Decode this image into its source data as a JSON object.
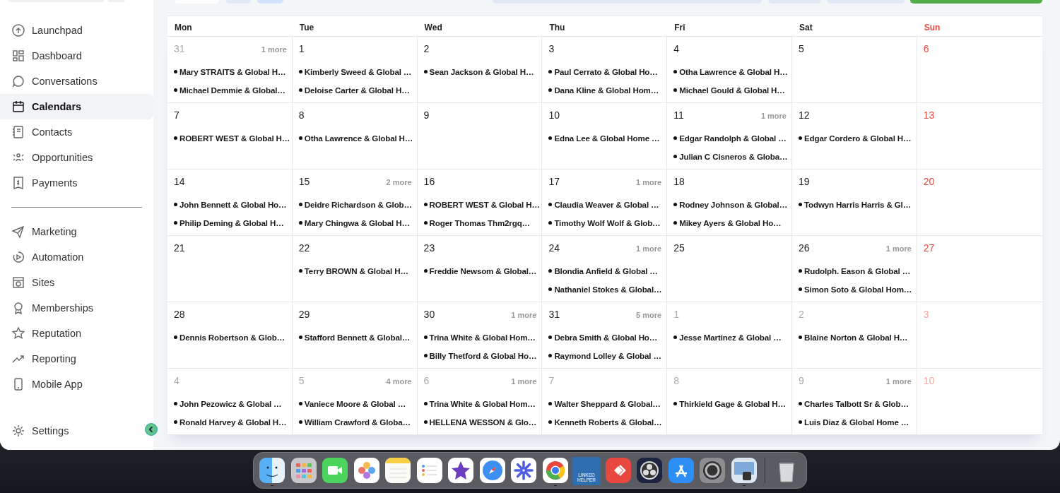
{
  "sidebar": {
    "groups": [
      [
        {
          "label": "Launchpad",
          "selected": false
        },
        {
          "label": "Dashboard",
          "selected": false
        },
        {
          "label": "Conversations",
          "selected": false
        },
        {
          "label": "Calendars",
          "selected": true
        },
        {
          "label": "Contacts",
          "selected": false
        },
        {
          "label": "Opportunities",
          "selected": false
        },
        {
          "label": "Payments",
          "selected": false
        }
      ],
      [
        {
          "label": "Marketing",
          "selected": false
        },
        {
          "label": "Automation",
          "selected": false
        },
        {
          "label": "Sites",
          "selected": false
        },
        {
          "label": "Memberships",
          "selected": false
        },
        {
          "label": "Reputation",
          "selected": false
        },
        {
          "label": "Reporting",
          "selected": false
        },
        {
          "label": "Mobile App",
          "selected": false
        }
      ]
    ],
    "settings": {
      "label": "Settings",
      "selected": false
    }
  },
  "calendar": {
    "weekdays": [
      {
        "label": "Mon",
        "weekend": false
      },
      {
        "label": "Tue",
        "weekend": false
      },
      {
        "label": "Wed",
        "weekend": false
      },
      {
        "label": "Thu",
        "weekend": false
      },
      {
        "label": "Fri",
        "weekend": false
      },
      {
        "label": "Sat",
        "weekend": false
      },
      {
        "label": "Sun",
        "weekend": true
      }
    ],
    "weeks": [
      [
        {
          "day": "31",
          "muted": true,
          "weekend": false,
          "more": "1 more",
          "events": [
            "Mary STRAITS & Global H…",
            "Michael Demmie & Global…"
          ]
        },
        {
          "day": "1",
          "muted": false,
          "weekend": false,
          "events": [
            "Kimberly Sweed & Global …",
            "Deloise Carter & Global H…"
          ]
        },
        {
          "day": "2",
          "muted": false,
          "weekend": false,
          "events": [
            "Sean Jackson & Global H…"
          ]
        },
        {
          "day": "3",
          "muted": false,
          "weekend": false,
          "events": [
            "Paul Cerrato & Global Ho…",
            "Dana Kline & Global Hom…"
          ]
        },
        {
          "day": "4",
          "muted": false,
          "weekend": false,
          "events": [
            "Otha Lawrence & Global H…",
            "Michael Gould & Global H…"
          ]
        },
        {
          "day": "5",
          "muted": false,
          "weekend": false
        },
        {
          "day": "6",
          "muted": false,
          "weekend": true
        }
      ],
      [
        {
          "day": "7",
          "muted": false,
          "weekend": false,
          "events": [
            "ROBERT WEST & Global H…"
          ]
        },
        {
          "day": "8",
          "muted": false,
          "weekend": false,
          "events": [
            "Otha Lawrence & Global H…"
          ]
        },
        {
          "day": "9",
          "muted": false,
          "weekend": false
        },
        {
          "day": "10",
          "muted": false,
          "weekend": false,
          "events": [
            "Edna Lee & Global Home …"
          ]
        },
        {
          "day": "11",
          "muted": false,
          "weekend": false,
          "more": "1 more",
          "events": [
            "Edgar Randolph & Global …",
            "Julian C Cisneros & Globa…"
          ]
        },
        {
          "day": "12",
          "muted": false,
          "weekend": false,
          "events": [
            "Edgar Cordero & Global H…"
          ]
        },
        {
          "day": "13",
          "muted": false,
          "weekend": true
        }
      ],
      [
        {
          "day": "14",
          "muted": false,
          "weekend": false,
          "events": [
            "John Bennett & Global Ho…",
            "Philip Deming & Global H…"
          ]
        },
        {
          "day": "15",
          "muted": false,
          "weekend": false,
          "more": "2 more",
          "events": [
            "Deidre Richardson & Glob…",
            "Mary Chingwa & Global H…"
          ]
        },
        {
          "day": "16",
          "muted": false,
          "weekend": false,
          "events": [
            "ROBERT WEST & Global H…",
            "Roger Thomas Thm2rgq…"
          ]
        },
        {
          "day": "17",
          "muted": false,
          "weekend": false,
          "more": "1 more",
          "events": [
            "Claudia Weaver & Global …",
            "Timothy Wolf Wolf & Glob…"
          ]
        },
        {
          "day": "18",
          "muted": false,
          "weekend": false,
          "events": [
            "Rodney Johnson & Global…",
            "Mikey Ayers & Global Ho…"
          ]
        },
        {
          "day": "19",
          "muted": false,
          "weekend": false,
          "events": [
            "Todwyn Harris Harris & Gl…"
          ]
        },
        {
          "day": "20",
          "muted": false,
          "weekend": true
        }
      ],
      [
        {
          "day": "21",
          "muted": false,
          "weekend": false
        },
        {
          "day": "22",
          "muted": false,
          "weekend": false,
          "events": [
            "Terry BROWN & Global H…"
          ]
        },
        {
          "day": "23",
          "muted": false,
          "weekend": false,
          "events": [
            "Freddie Newsom & Global…"
          ]
        },
        {
          "day": "24",
          "muted": false,
          "weekend": false,
          "more": "1 more",
          "events": [
            "Blondia Anfield & Global …",
            "Nathaniel Stokes & Global…"
          ]
        },
        {
          "day": "25",
          "muted": false,
          "weekend": false
        },
        {
          "day": "26",
          "muted": false,
          "weekend": false,
          "more": "1 more",
          "events": [
            "Rudolph. Eason & Global …",
            "Simon Soto & Global Hom…"
          ]
        },
        {
          "day": "27",
          "muted": false,
          "weekend": true
        }
      ],
      [
        {
          "day": "28",
          "muted": false,
          "weekend": false,
          "events": [
            "Dennis Robertson & Glob…"
          ]
        },
        {
          "day": "29",
          "muted": false,
          "weekend": false,
          "events": [
            "Stafford Bennett & Global…"
          ]
        },
        {
          "day": "30",
          "muted": false,
          "weekend": false,
          "more": "1 more",
          "events": [
            "Trina White & Global Hom…",
            "Billy Thetford & Global Ho…"
          ]
        },
        {
          "day": "31",
          "muted": false,
          "weekend": false,
          "more": "5 more",
          "events": [
            "Debra Smith & Global Ho…",
            "Raymond Lolley & Global …"
          ]
        },
        {
          "day": "1",
          "muted": true,
          "weekend": false,
          "events": [
            "Jesse Martinez & Global …"
          ]
        },
        {
          "day": "2",
          "muted": true,
          "weekend": false,
          "events": [
            "Blaine Norton & Global H…"
          ]
        },
        {
          "day": "3",
          "muted": true,
          "weekend": true
        }
      ],
      [
        {
          "day": "4",
          "muted": true,
          "weekend": false,
          "events": [
            "John Pezowicz & Global …",
            "Ronald Harvey & Global H…"
          ]
        },
        {
          "day": "5",
          "muted": true,
          "weekend": false,
          "more": "4 more",
          "events": [
            "Vaniece Moore & Global …",
            "William Crawford & Globa…"
          ]
        },
        {
          "day": "6",
          "muted": true,
          "weekend": false,
          "more": "1 more",
          "events": [
            "Trina White & Global Hom…",
            "HELLENA WESSON & Glo…"
          ]
        },
        {
          "day": "7",
          "muted": true,
          "weekend": false,
          "events": [
            "Walter Sheppard & Global…",
            "Kenneth Roberts & Global…"
          ]
        },
        {
          "day": "8",
          "muted": true,
          "weekend": false,
          "events": [
            "Thirkield Gage & Global H…"
          ]
        },
        {
          "day": "9",
          "muted": true,
          "weekend": false,
          "more": "1 more",
          "events": [
            "Charles Talbott Sr & Glob…",
            "Luis Diaz & Global Home …"
          ]
        },
        {
          "day": "10",
          "muted": true,
          "weekend": true
        }
      ]
    ]
  },
  "dock": {
    "items": [
      {
        "running": true
      },
      {
        "running": false
      },
      {
        "running": false
      },
      {
        "running": false
      },
      {
        "running": false
      },
      {
        "running": false
      },
      {
        "running": false
      },
      {
        "running": false
      },
      {
        "running": false
      },
      {
        "running": true
      },
      {
        "running": false,
        "label": "LINKED HELPER"
      },
      {
        "running": false
      },
      {
        "running": false
      },
      {
        "running": false
      },
      {
        "running": false
      },
      {
        "running": true
      },
      {
        "running": false
      }
    ]
  }
}
